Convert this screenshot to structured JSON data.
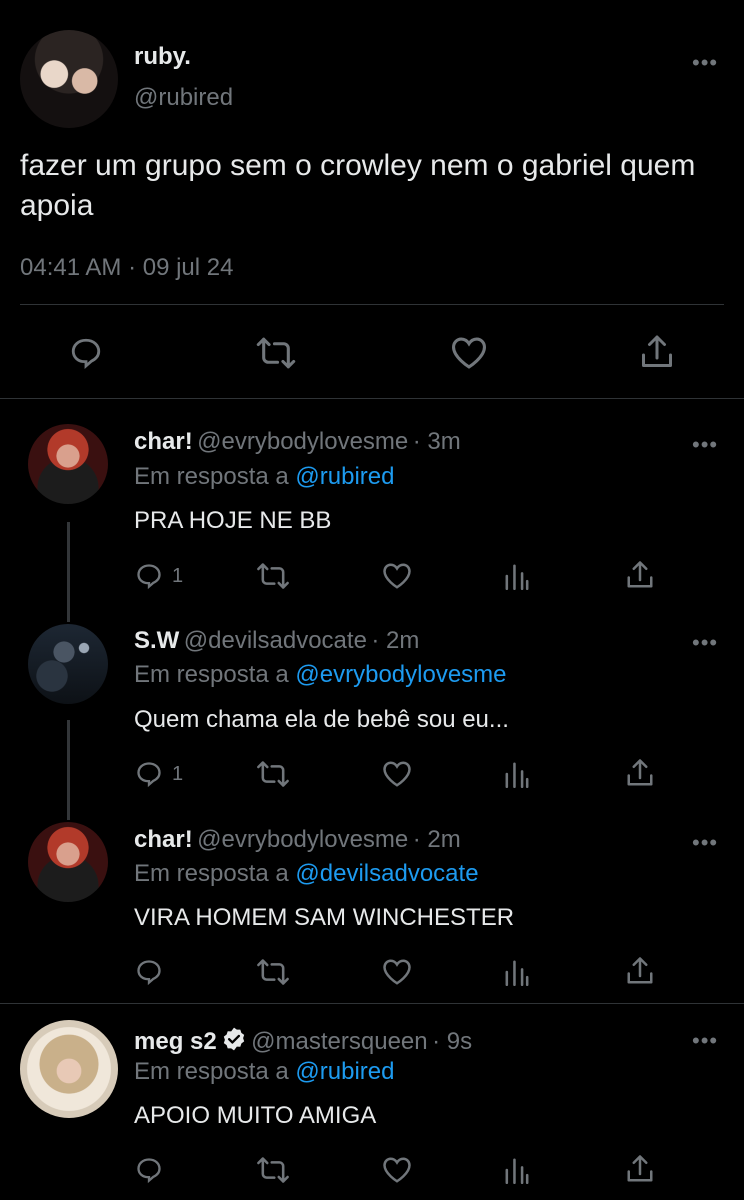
{
  "main_tweet": {
    "name": "ruby.",
    "handle": "@rubired",
    "text": "fazer um grupo sem o crowley nem o gabriel quem apoia",
    "time": "04:41 AM · 09 jul 24"
  },
  "replies": [
    {
      "name": "char!",
      "handle": "@evrybodylovesme",
      "time": "· 3m",
      "reply_prefix": "Em resposta a",
      "reply_to": "@rubired",
      "text": "PRA HOJE NE BB",
      "reply_count": "1"
    },
    {
      "name": "S.W",
      "handle": "@devilsadvocate",
      "time": "· 2m",
      "reply_prefix": "Em resposta a",
      "reply_to": "@evrybodylovesme",
      "text": "Quem chama ela de bebê sou eu...",
      "reply_count": "1"
    },
    {
      "name": "char!",
      "handle": "@evrybodylovesme",
      "time": "· 2m",
      "reply_prefix": "Em resposta a",
      "reply_to": "@devilsadvocate",
      "text": "VIRA HOMEM SAM WINCHESTER",
      "reply_count": ""
    },
    {
      "name": "meg s2",
      "handle": "@mastersqueen",
      "time": "· 9s",
      "reply_prefix": "Em resposta a",
      "reply_to": "@rubired",
      "text": "APOIO MUITO AMIGA",
      "reply_count": ""
    }
  ],
  "icons": {
    "reply": "reply-icon",
    "retweet": "retweet-icon",
    "like": "heart-icon",
    "views": "views-icon",
    "share": "share-icon",
    "more": "more-icon",
    "verified": "verified-badge-icon"
  },
  "colors": {
    "background": "#000000",
    "text": "#e7e9ea",
    "muted": "#71767b",
    "link": "#1d9bf0"
  }
}
